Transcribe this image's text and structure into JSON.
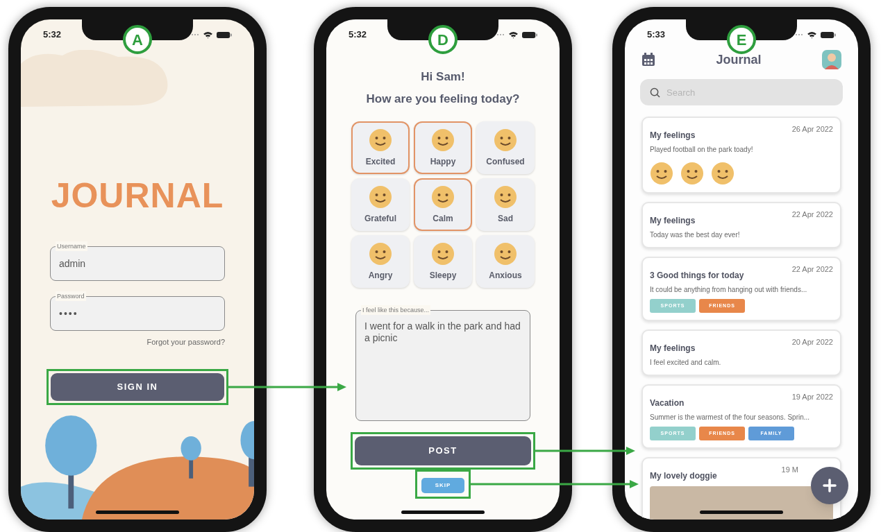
{
  "login_screen": {
    "time": "5:32",
    "badge": "A",
    "logo": "JOURNAL",
    "username": {
      "label": "Username",
      "value": "admin"
    },
    "password": {
      "label": "Password",
      "value": "••••"
    },
    "forgot_link": "Forgot your password?",
    "sign_in_button": {
      "label": "SIGN IN",
      "highlighted": true
    }
  },
  "mood_screen": {
    "time": "5:32",
    "badge": "D",
    "greeting": "Hi Sam!",
    "question": "How are you feeling today?",
    "moods": [
      {
        "label": "Excited",
        "selected": true
      },
      {
        "label": "Happy",
        "selected": true
      },
      {
        "label": "Confused",
        "selected": false
      },
      {
        "label": "Grateful",
        "selected": false
      },
      {
        "label": "Calm",
        "selected": true
      },
      {
        "label": "Sad",
        "selected": false
      },
      {
        "label": "Angry",
        "selected": false
      },
      {
        "label": "Sleepy",
        "selected": false
      },
      {
        "label": "Anxious",
        "selected": false
      }
    ],
    "reason_field": {
      "label": "I feel like this because...",
      "value": "I went for a walk in the park and had a picnic"
    },
    "post_button": {
      "label": "POST",
      "highlighted": true
    },
    "skip_button": {
      "label": "SKIP",
      "highlighted": true
    }
  },
  "journal_screen": {
    "time": "5:33",
    "badge": "E",
    "title": "Journal",
    "search": {
      "placeholder": "Search"
    },
    "entries": [
      {
        "kind": "moods",
        "title": "My feelings",
        "date": "26 Apr 2022",
        "text": "Played football on the park toady!"
      },
      {
        "kind": "plain",
        "title": "My feelings",
        "date": "22 Apr 2022",
        "text": "Today was the best day ever!"
      },
      {
        "kind": "tags",
        "title": "3 Good things for today",
        "date": "22 Apr 2022",
        "text": "It could be anything from hanging out with friends...",
        "tags": [
          {
            "label": "SPORTS",
            "color": "#93d0cc"
          },
          {
            "label": "FRIENDS",
            "color": "#e8874a"
          }
        ]
      },
      {
        "kind": "plain",
        "title": "My feelings",
        "date": "20 Apr 2022",
        "text": "I feel excited and calm."
      },
      {
        "kind": "tags",
        "title": "Vacation",
        "date": "19 Apr 2022",
        "text": "Summer is the warmest of the four seasons. Sprin...",
        "tags": [
          {
            "label": "SPORTS",
            "color": "#93d0cc"
          },
          {
            "label": "FRIENDS",
            "color": "#e8874a"
          },
          {
            "label": "FAMILY",
            "color": "#5f9bd8"
          }
        ]
      },
      {
        "kind": "photo",
        "title": "My lovely doggie",
        "date": "19 M"
      }
    ]
  }
}
